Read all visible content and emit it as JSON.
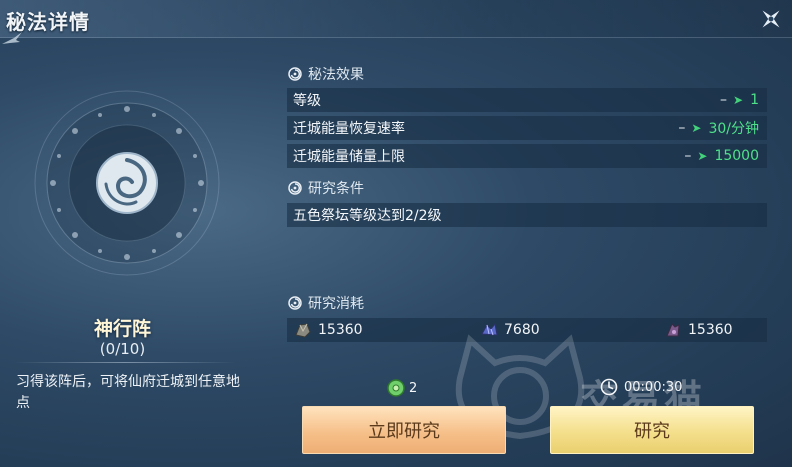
{
  "window": {
    "title": "秘法详情"
  },
  "secret_art": {
    "name": "神行阵",
    "level": "(0/10)",
    "description": "习得该阵后，可将仙府迁城到任意地点"
  },
  "effects": {
    "heading": "秘法效果",
    "rows": [
      {
        "label": "等级",
        "from": "–",
        "to": "1"
      },
      {
        "label": "迁城能量恢复速率",
        "from": "–",
        "to": "30/分钟"
      },
      {
        "label": "迁城能量储量上限",
        "from": "–",
        "to": "15000"
      }
    ]
  },
  "conditions": {
    "heading": "研究条件",
    "rows": [
      {
        "label": "五色祭坛等级达到2/2级"
      }
    ]
  },
  "costs": {
    "heading": "研究消耗",
    "items": [
      {
        "icon": "ore-icon",
        "amount": "15360"
      },
      {
        "icon": "crystal-icon",
        "amount": "7680"
      },
      {
        "icon": "wood-icon",
        "amount": "15360"
      }
    ]
  },
  "instant": {
    "jade_count": "2",
    "button_label": "立即研究"
  },
  "research": {
    "time": "00:00:30",
    "button_label": "研究"
  },
  "watermark": {
    "text": "交易猫"
  },
  "colors": {
    "accent_green": "#4fe08a",
    "button_orange": "#f6c08a",
    "button_yellow": "#f4df8c"
  }
}
